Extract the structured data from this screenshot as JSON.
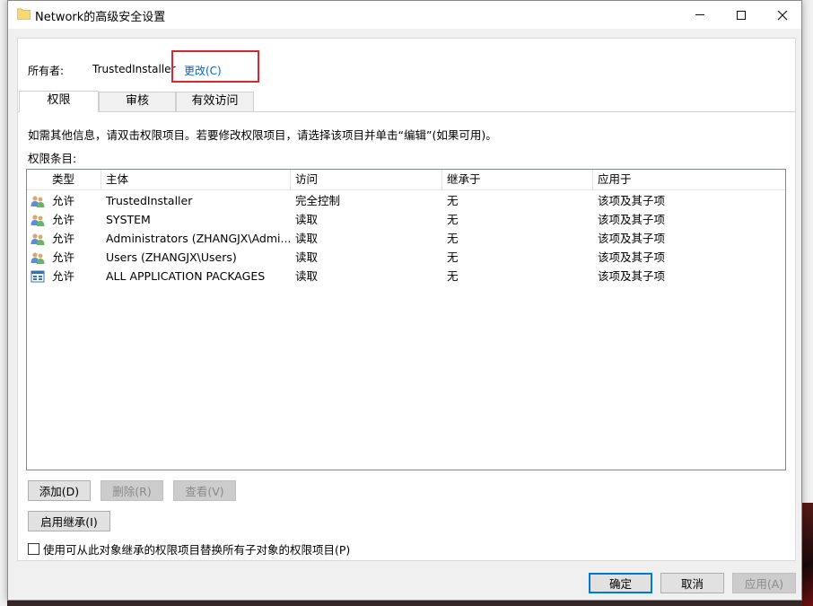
{
  "window": {
    "title": "Network的高级安全设置"
  },
  "owner": {
    "label": "所有者:",
    "value": "TrustedInstaller",
    "change_link": "更改(C)"
  },
  "tabs": [
    {
      "label": "权限",
      "active": true
    },
    {
      "label": "审核",
      "active": false
    },
    {
      "label": "有效访问",
      "active": false
    }
  ],
  "info_text": "如需其他信息，请双击权限项目。若要修改权限项目，请选择该项目并单击“编辑”(如果可用)。",
  "entries_label": "权限条目:",
  "table": {
    "columns": [
      "类型",
      "主体",
      "访问",
      "继承于",
      "应用于"
    ],
    "rows": [
      {
        "icon": "user-group-icon",
        "type": "允许",
        "principal": "TrustedInstaller",
        "access": "完全控制",
        "inherited": "无",
        "applies": "该项及其子项"
      },
      {
        "icon": "user-group-icon",
        "type": "允许",
        "principal": "SYSTEM",
        "access": "读取",
        "inherited": "无",
        "applies": "该项及其子项"
      },
      {
        "icon": "user-group-icon",
        "type": "允许",
        "principal": "Administrators (ZHANGJX\\Admi...",
        "access": "读取",
        "inherited": "无",
        "applies": "该项及其子项"
      },
      {
        "icon": "user-group-icon",
        "type": "允许",
        "principal": "Users (ZHANGJX\\Users)",
        "access": "读取",
        "inherited": "无",
        "applies": "该项及其子项"
      },
      {
        "icon": "app-packages-icon",
        "type": "允许",
        "principal": "ALL APPLICATION PACKAGES",
        "access": "读取",
        "inherited": "无",
        "applies": "该项及其子项"
      }
    ]
  },
  "buttons": {
    "add": "添加(D)",
    "remove": "删除(R)",
    "view": "查看(V)",
    "enable_inheritance": "启用继承(I)",
    "ok": "确定",
    "cancel": "取消",
    "apply": "应用(A)"
  },
  "replace_checkbox": {
    "label": "使用可从此对象继承的权限项目替换所有子对象的权限项目(P)",
    "checked": false
  },
  "colors": {
    "link": "#0066cc",
    "highlight": "#d9262e",
    "default_button_border": "#0078d7"
  }
}
